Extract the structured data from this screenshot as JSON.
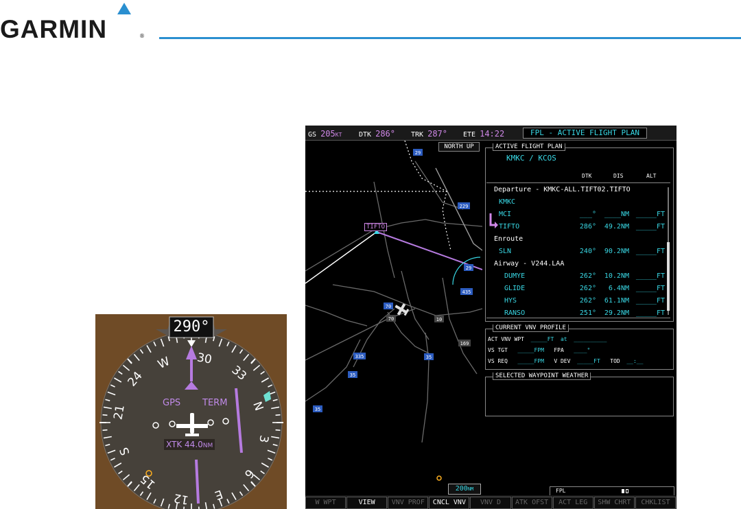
{
  "header": {
    "logo": "GARMIN",
    "registered": "®"
  },
  "hsi": {
    "heading": "290°",
    "gps_label": "GPS",
    "term_label": "TERM",
    "xtk_label": "XTK",
    "xtk_value": "44.0",
    "xtk_unit": "NM",
    "compass_labels": [
      "W",
      "30",
      "33",
      "N",
      "3",
      "6",
      "E",
      "12",
      "15",
      "S",
      "21",
      "24"
    ]
  },
  "topbar": {
    "gs_label": "GS",
    "gs_value": "205",
    "gs_unit": "KT",
    "dtk_label": "DTK",
    "dtk_value": "286°",
    "trk_label": "TRK",
    "trk_value": "287°",
    "ete_label": "ETE",
    "ete_value": "14:22",
    "title": "FPL - ACTIVE FLIGHT PLAN"
  },
  "map": {
    "orientation": "NORTH UP",
    "range": "200",
    "range_unit": "NM",
    "waypoint_label": "TIFTO",
    "highway_shields": [
      "29",
      "229",
      "29",
      "435",
      "70",
      "70",
      "10",
      "335",
      "35",
      "35",
      "35",
      "169"
    ]
  },
  "active_fp": {
    "title": "ACTIVE FLIGHT PLAN",
    "route": "KMKC / KCOS",
    "col_dtk": "DTK",
    "col_dis": "DIS",
    "col_alt": "ALT",
    "rows": [
      {
        "name": "Departure - KMKC-ALL.TIFT02.TIFTO",
        "kind": "header",
        "dtk": "",
        "dis": "",
        "alt": ""
      },
      {
        "name": "KMKC",
        "kind": "wpt",
        "dtk": "",
        "dis": "",
        "alt": ""
      },
      {
        "name": "MCI",
        "kind": "wpt",
        "dtk": "___°",
        "dis": "____NM",
        "alt": "_____FT"
      },
      {
        "name": "TIFTO",
        "kind": "wpt",
        "dtk": "286°",
        "dis": "49.2NM",
        "alt": "_____FT"
      },
      {
        "name": "Enroute",
        "kind": "header",
        "dtk": "",
        "dis": "",
        "alt": ""
      },
      {
        "name": "SLN",
        "kind": "wpt",
        "dtk": "240°",
        "dis": "90.2NM",
        "alt": "_____FT"
      },
      {
        "name": "Airway - V244.LAA",
        "kind": "header",
        "dtk": "",
        "dis": "",
        "alt": ""
      },
      {
        "name": "DUMYE",
        "kind": "airway",
        "dtk": "262°",
        "dis": "10.2NM",
        "alt": "_____FT"
      },
      {
        "name": "GLIDE",
        "kind": "airway",
        "dtk": "262°",
        "dis": "6.4NM",
        "alt": "_____FT"
      },
      {
        "name": "HYS",
        "kind": "airway",
        "dtk": "262°",
        "dis": "61.1NM",
        "alt": "_____FT"
      },
      {
        "name": "RANSO",
        "kind": "airway",
        "dtk": "251°",
        "dis": "29.2NM",
        "alt": "_____FT"
      }
    ]
  },
  "vnv_profile": {
    "title": "CURRENT VNV PROFILE",
    "act_vnv_wpt_label": "ACT VNV WPT",
    "act_vnv_wpt_value": "_____FT",
    "at_label": "at",
    "at_value": "__________",
    "vs_tgt_label": "VS TGT",
    "vs_tgt_value": "_____FPM",
    "fpa_label": "FPA",
    "fpa_value": "____°",
    "vs_req_label": "VS REQ",
    "vs_req_value": "_____FPM",
    "vdev_label": "V DEV",
    "vdev_value": "_____FT",
    "tod_label": "TOD",
    "tod_value": "__:__"
  },
  "weather": {
    "title": "SELECTED WAYPOINT WEATHER"
  },
  "status": {
    "fpl_label": "FPL"
  },
  "softkeys": [
    {
      "label": "W WPT",
      "enabled": false
    },
    {
      "label": "VIEW",
      "enabled": true
    },
    {
      "label": "VNV PROF",
      "enabled": false
    },
    {
      "label": "CNCL VNV",
      "enabled": true
    },
    {
      "label": "VNV D",
      "enabled": false
    },
    {
      "label": "ATK OFST",
      "enabled": false
    },
    {
      "label": "ACT LEG",
      "enabled": false
    },
    {
      "label": "SHW CHRT",
      "enabled": false
    },
    {
      "label": "CHKLIST",
      "enabled": false
    }
  ],
  "colors": {
    "cyan": "#39d9e6",
    "magenta": "#d088e8",
    "hsi_brown": "#6f4b26",
    "garmin_blue": "#2a8fd0"
  }
}
